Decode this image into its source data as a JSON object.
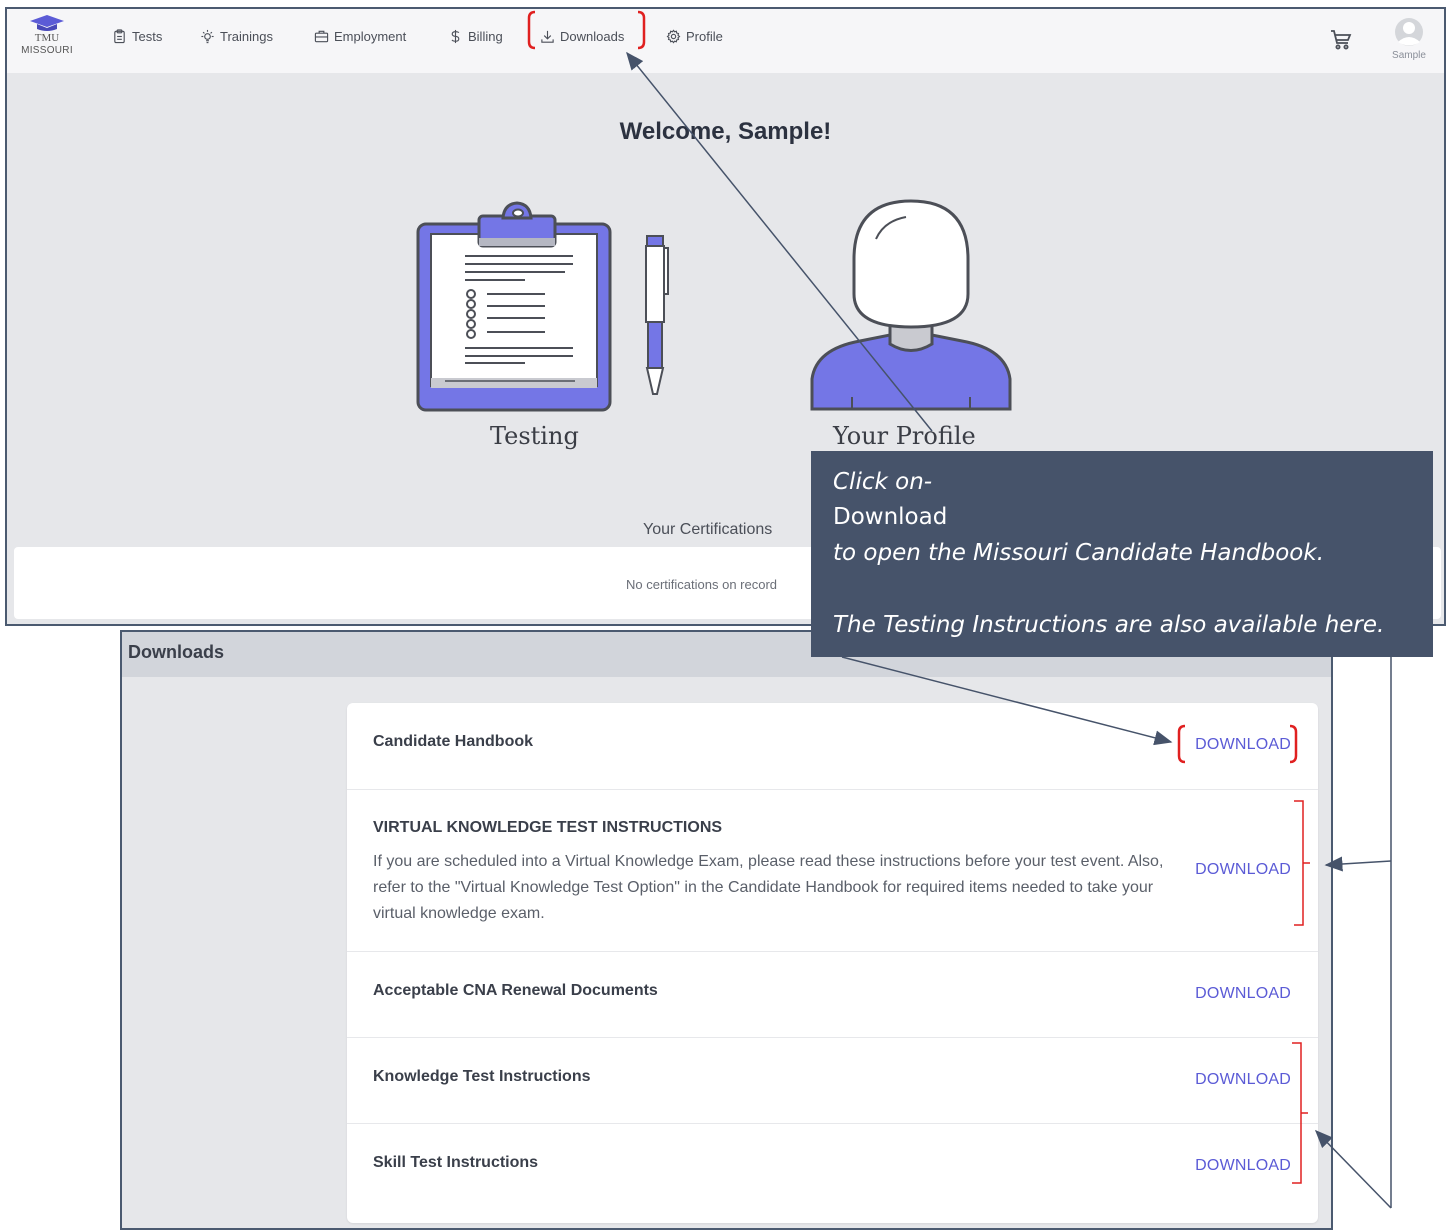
{
  "nav": {
    "logo_line1": "TMU",
    "logo_line2": "MISSOURI",
    "items": [
      {
        "label": "Tests",
        "icon": "clipboard-icon"
      },
      {
        "label": "Trainings",
        "icon": "lightbulb-icon"
      },
      {
        "label": "Employment",
        "icon": "briefcase-icon"
      },
      {
        "label": "Billing",
        "icon": "dollar-icon"
      },
      {
        "label": "Downloads",
        "icon": "download-icon"
      },
      {
        "label": "Profile",
        "icon": "gear-icon"
      }
    ],
    "cart_icon": "cart-icon",
    "user_name": "Sample"
  },
  "dashboard": {
    "welcome": "Welcome, Sample!",
    "testing_label": "Testing",
    "profile_label": "Your Profile",
    "certifications_title": "Your Certifications",
    "certifications_empty": "No certifications on record"
  },
  "downloads": {
    "title": "Downloads",
    "link_label": "DOWNLOAD",
    "items": [
      {
        "title": "Candidate Handbook",
        "description": ""
      },
      {
        "title": "VIRTUAL KNOWLEDGE TEST INSTRUCTIONS",
        "description": "If you are scheduled into a Virtual Knowledge Exam, please read these instructions before your test event. Also, refer to the \"Virtual Knowledge Test Option\" in the Candidate Handbook for required items needed to take your virtual knowledge exam."
      },
      {
        "title": "Acceptable CNA Renewal Documents",
        "description": ""
      },
      {
        "title": "Knowledge Test Instructions",
        "description": ""
      },
      {
        "title": "Skill Test Instructions",
        "description": ""
      }
    ]
  },
  "callout": {
    "line1": "Click on-",
    "line2": "Download",
    "line3": "to open the Missouri Candidate Handbook.",
    "line4": "The Testing Instructions are also available here."
  },
  "colors": {
    "accent": "#5b5bd6",
    "highlight": "#e02020",
    "callout_bg": "#46536a",
    "arrow": "#46536a"
  }
}
